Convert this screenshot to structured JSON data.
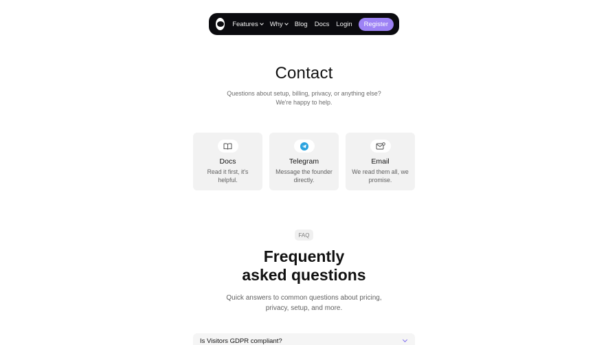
{
  "nav": {
    "items": [
      {
        "label": "Features",
        "has_dropdown": true
      },
      {
        "label": "Why",
        "has_dropdown": true
      },
      {
        "label": "Blog",
        "has_dropdown": false
      },
      {
        "label": "Docs",
        "has_dropdown": false
      }
    ],
    "login_label": "Login",
    "register_label": "Register"
  },
  "header": {
    "title": "Contact",
    "subtitle_line1": "Questions about setup, billing, privacy, or anything else?",
    "subtitle_line2": "We're happy to help."
  },
  "cards": [
    {
      "icon": "book-icon",
      "title": "Docs",
      "desc": "Read it first, it's helpful."
    },
    {
      "icon": "telegram-icon",
      "title": "Telegram",
      "desc": "Message the founder directly."
    },
    {
      "icon": "mail-icon",
      "title": "Email",
      "desc": "We read them all, we promise."
    }
  ],
  "faq": {
    "badge": "FAQ",
    "title_line1": "Frequently",
    "title_line2": "asked questions",
    "sub_line1": "Quick answers to common questions about pricing,",
    "sub_line2": "privacy, setup, and more.",
    "items": [
      {
        "question": "Is Visitors GDPR compliant?"
      }
    ]
  },
  "colors": {
    "nav_bg": "#0b0b0f",
    "accent": "#9d82f5",
    "card_bg": "#f2f2f2",
    "telegram_blue": "#2aa3df"
  }
}
